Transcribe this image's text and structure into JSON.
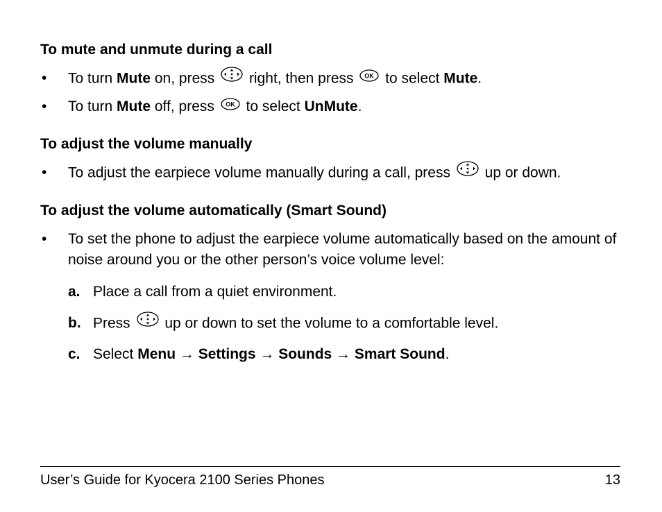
{
  "sections": {
    "mute": {
      "heading": "To mute and unmute during a call",
      "item1": {
        "pre": "To turn ",
        "bold1": "Mute",
        "mid1": " on, press ",
        "mid2": " right, then press ",
        "mid3": " to select ",
        "bold2": "Mute",
        "post": "."
      },
      "item2": {
        "pre": "To turn ",
        "bold1": "Mute",
        "mid1": " off, press ",
        "mid2": " to select ",
        "bold2": "UnMute",
        "post": "."
      }
    },
    "manual": {
      "heading": "To adjust the volume manually",
      "item1": {
        "pre": "To adjust the earpiece volume manually during a call, press ",
        "post": " up or down."
      }
    },
    "auto": {
      "heading": "To adjust the volume automatically (Smart Sound)",
      "intro": "To set the phone to adjust the earpiece volume automatically based on the amount of noise around you or the other person’s voice volume level:",
      "steps": {
        "a": {
          "mark": "a.",
          "text": "Place a call from a quiet environment."
        },
        "b": {
          "mark": "b.",
          "pre": "Press ",
          "post": " up or down to set the volume to a comfortable level."
        },
        "c": {
          "mark": "c.",
          "pre": "Select ",
          "m1": "Menu",
          "arrow": " → ",
          "m2": "Settings",
          "m3": "Sounds",
          "m4": "Smart Sound",
          "post": "."
        }
      }
    }
  },
  "footer": {
    "title": "User’s Guide for Kyocera 2100 Series Phones",
    "page": "13"
  },
  "icons": {
    "nav": "nav-pad-icon",
    "ok": "ok-button-icon"
  }
}
